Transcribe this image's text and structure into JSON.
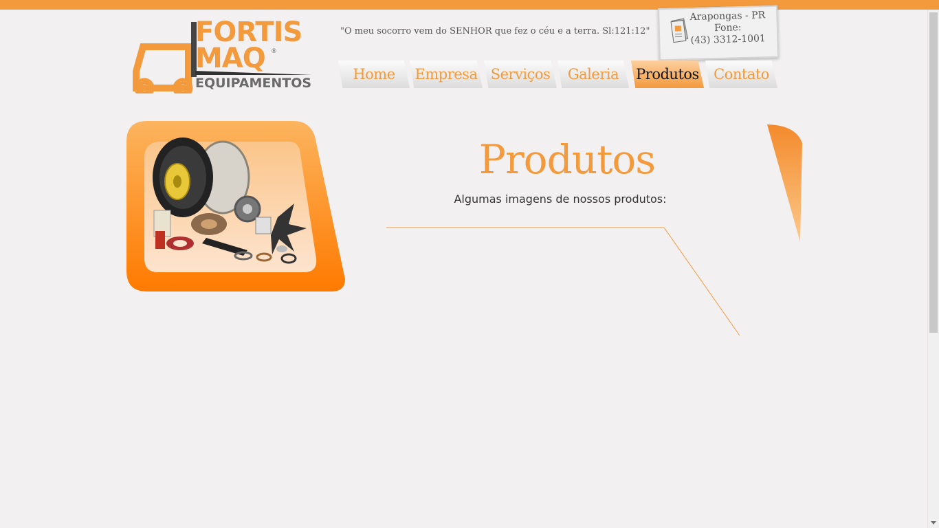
{
  "header": {
    "logo": {
      "line1": "FORTIS",
      "line2": "MAQ",
      "reg": "®",
      "line3": "EQUIPAMENTOS"
    },
    "quote": "\"O meu socorro vem do SENHOR que fez o céu e a terra. Sl:121:12\"",
    "contact": {
      "city": "Arapongas - PR",
      "fone_label": "Fone:",
      "phone": "(43) 3312-1001"
    }
  },
  "nav": {
    "items": [
      {
        "label": "Home"
      },
      {
        "label": "Empresa"
      },
      {
        "label": "Serviços"
      },
      {
        "label": "Galeria"
      },
      {
        "label": "Produtos"
      },
      {
        "label": "Contato"
      }
    ],
    "active": "Produtos"
  },
  "main": {
    "title": "Produtos",
    "subtitle": "Algumas imagens de nossos produtos:"
  },
  "colors": {
    "accent": "#f39a3c",
    "accent_dark": "#ff7a00",
    "background": "#f2f0f1"
  }
}
